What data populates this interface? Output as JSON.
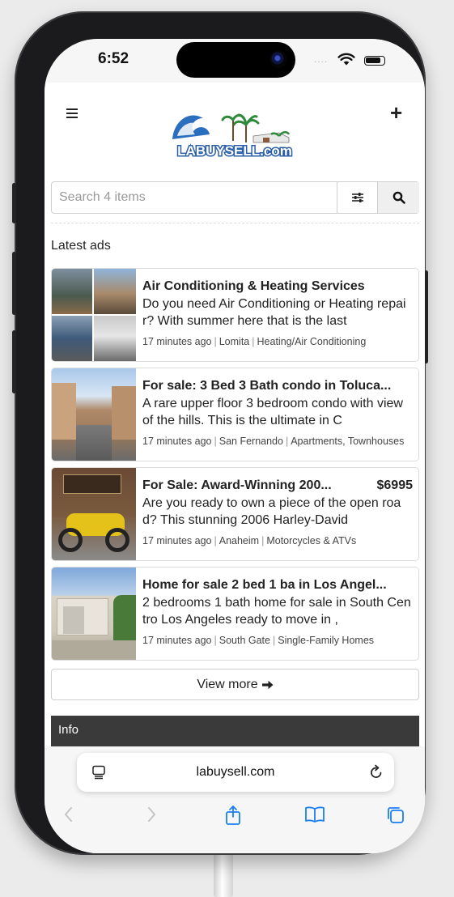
{
  "status": {
    "time": "6:52"
  },
  "header": {
    "logo_text": "LABUYSELL.com"
  },
  "search": {
    "placeholder": "Search 4 items"
  },
  "section_title": "Latest ads",
  "ads": [
    {
      "title": "Air Conditioning & Heating Services",
      "price": "",
      "description": "Do you need Air Conditioning or Heating repair? With summer here that is the last",
      "time": "17 minutes ago",
      "location": "Lomita",
      "category": "Heating/Air Conditioning"
    },
    {
      "title": "For sale: 3 Bed 3 Bath condo in Toluca...",
      "price": "",
      "description": "A rare upper floor 3 bedroom condo with view of the hills. This is the ultimate in C",
      "time": "17 minutes ago",
      "location": "San Fernando",
      "category": "Apartments, Townhouses"
    },
    {
      "title": "For Sale: Award-Winning 200...",
      "price": "$6995",
      "description": "Are you ready to own a piece of the open road? This stunning 2006 Harley-David",
      "time": "17 minutes ago",
      "location": "Anaheim",
      "category": "Motorcycles & ATVs"
    },
    {
      "title": "Home for sale 2 bed 1 ba in Los Angel...",
      "price": "",
      "description": "2 bedrooms 1 bath home for sale in South Centro Los Angeles ready to move in ,",
      "time": "17 minutes ago",
      "location": "South Gate",
      "category": "Single-Family Homes"
    }
  ],
  "view_more_label": "View more",
  "info_label": "Info",
  "browser": {
    "url": "labuysell.com"
  },
  "icons": {
    "menu": "hamburger-icon",
    "add": "plus-icon",
    "filter": "sliders-icon",
    "search": "search-icon",
    "tabs": "tab-overview-icon",
    "reload": "reload-icon",
    "back": "chevron-left-icon",
    "forward": "chevron-right-icon",
    "share": "share-icon",
    "bookmarks": "book-icon",
    "pages": "tabs-icon"
  },
  "colors": {
    "accent_blue": "#1a7ef5",
    "info_bar": "#3a3a3a",
    "logo_blue": "#2a5fa8"
  }
}
